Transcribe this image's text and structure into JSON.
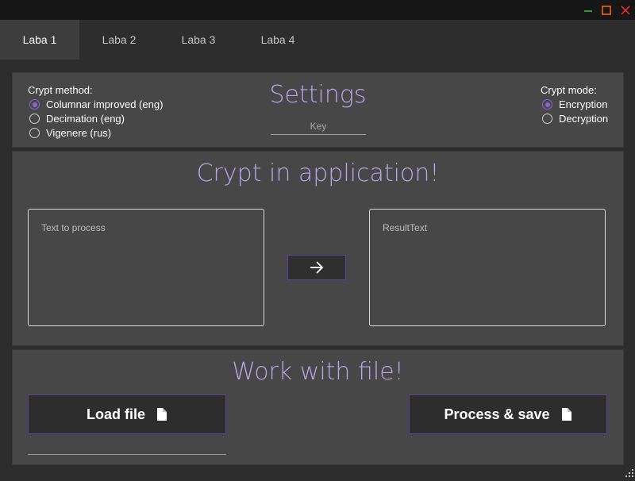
{
  "window": {
    "controls": {
      "minimize_color": "#2ecc40",
      "maximize_color": "#ff6a00",
      "close_color": "#ff2a2a"
    }
  },
  "tabs": [
    {
      "label": "Laba 1",
      "active": true
    },
    {
      "label": "Laba 2",
      "active": false
    },
    {
      "label": "Laba 3",
      "active": false
    },
    {
      "label": "Laba 4",
      "active": false
    }
  ],
  "settings": {
    "title": "Settings",
    "method_label": "Crypt method:",
    "methods": [
      {
        "label": "Columnar improved (eng)",
        "checked": true
      },
      {
        "label": "Decimation (eng)",
        "checked": false
      },
      {
        "label": "Vigenere (rus)",
        "checked": false
      }
    ],
    "key_placeholder": "Key",
    "key_value": "",
    "mode_label": "Crypt mode:",
    "modes": [
      {
        "label": "Encryption",
        "checked": true
      },
      {
        "label": "Decryption",
        "checked": false
      }
    ]
  },
  "crypt": {
    "title": "Crypt in application!",
    "input_placeholder": "Text to process",
    "input_value": "",
    "output_text": "ResultText",
    "arrow_icon": "arrow-right-icon"
  },
  "file": {
    "title": "Work with file!",
    "load_label": "Load file",
    "save_label": "Process & save",
    "file_icon": "document-icon",
    "path_value": ""
  },
  "colors": {
    "accent": "#b7a7e6",
    "radio_accent": "#8a63d6",
    "button_border": "#5b3fa3",
    "panel_bg": "#474747",
    "app_bg": "#2d2d2d"
  }
}
